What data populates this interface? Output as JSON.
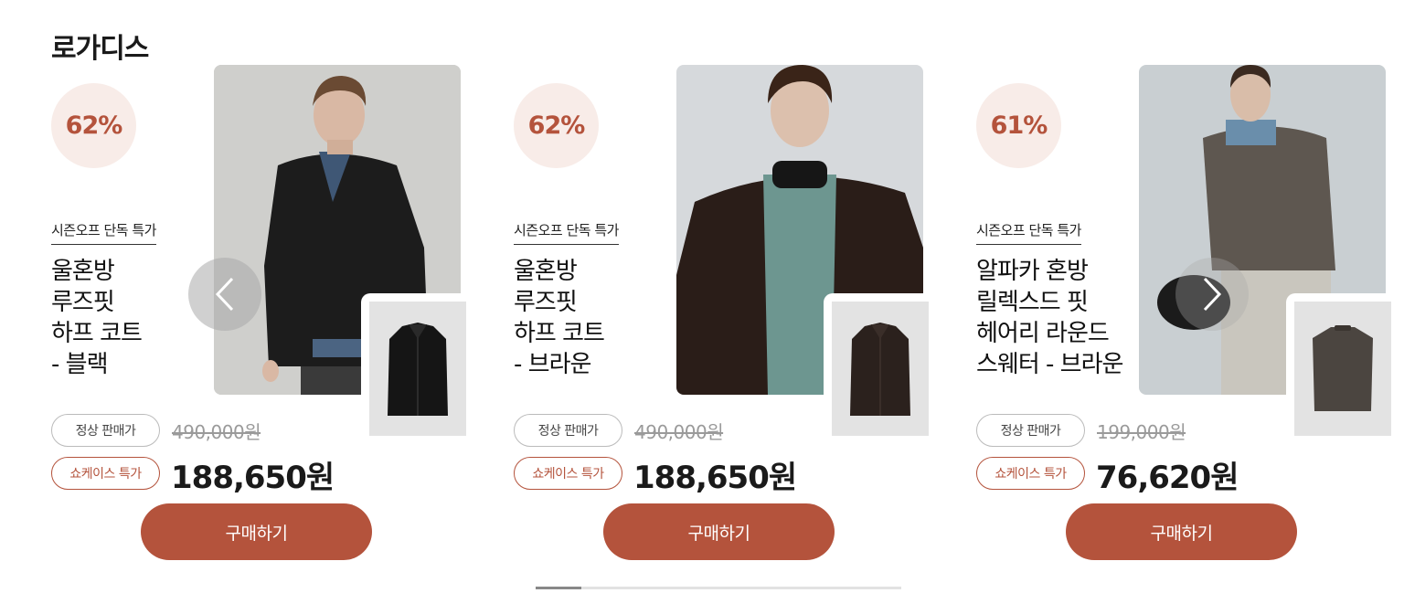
{
  "brand": {
    "title": "로가디스"
  },
  "products": [
    {
      "discount": "62%",
      "promo": "시즌오프 단독 특가",
      "name_lines": [
        "울혼방",
        "루즈핏",
        "하프 코트",
        "- 블랙"
      ],
      "regular_label": "정상 판매가",
      "original_price": "490,000원",
      "special_label": "쇼케이스 특가",
      "sale_price": "188,650원",
      "buy_label": "구매하기"
    },
    {
      "discount": "62%",
      "promo": "시즌오프 단독 특가",
      "name_lines": [
        "울혼방",
        "루즈핏",
        "하프 코트",
        "- 브라운"
      ],
      "regular_label": "정상 판매가",
      "original_price": "490,000원",
      "special_label": "쇼케이스 특가",
      "sale_price": "188,650원",
      "buy_label": "구매하기"
    },
    {
      "discount": "61%",
      "promo": "시즌오프 단독 특가",
      "name_lines": [
        "알파카 혼방",
        "릴렉스드 핏",
        "헤어리 라운드",
        "스웨터 - 브라운"
      ],
      "regular_label": "정상 판매가",
      "original_price": "199,000원",
      "special_label": "쇼케이스 특가",
      "sale_price": "76,620원",
      "buy_label": "구매하기"
    }
  ],
  "carousel": {
    "progress": 0.125
  },
  "colors": {
    "accent": "#b4533c",
    "discount_bg": "#f8ece8"
  },
  "icons": {
    "prev": "chevron-left-icon",
    "next": "chevron-right-icon"
  }
}
